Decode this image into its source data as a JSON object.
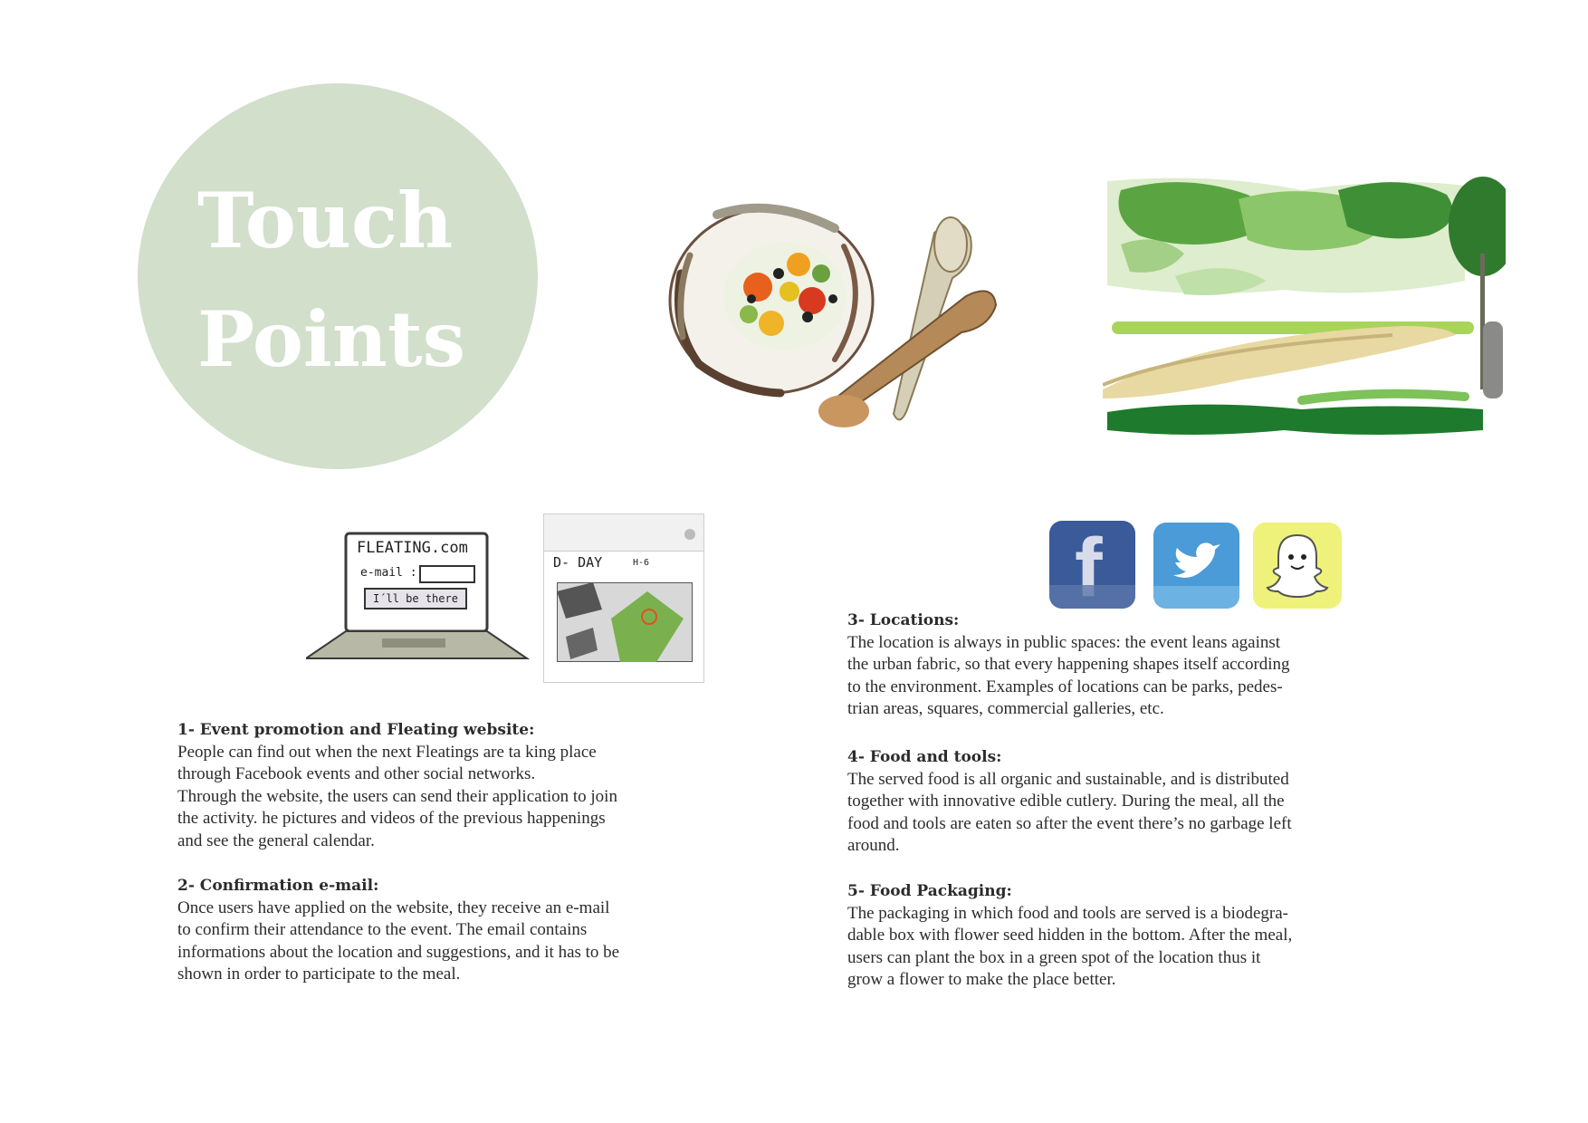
{
  "title": {
    "line1": "Touch",
    "line2": "Points"
  },
  "laptop": {
    "site_name": "FLEATING.com",
    "email_label": "e-mail :",
    "cta": "I´ll be there"
  },
  "email_mock": {
    "heading": "D- DAY",
    "time": "H-6"
  },
  "social": {
    "facebook_letter": "f"
  },
  "colors": {
    "circle": "#d2dfcb",
    "facebook": "#3b5a9a",
    "twitter": "#4a9bd8",
    "snapchat": "#eef27a"
  },
  "sections": [
    {
      "heading": "1- Event promotion and Fleating website:",
      "body": "People can find out when the next Fleatings are ta king place\nthrough Facebook events and other social networks.\nThrough the website, the users can send their application to join\nthe activity. he pictures and videos of the previous happenings\nand see the general calendar."
    },
    {
      "heading": "2- Confirmation e-mail:",
      "body": "Once users have applied on the website, they receive an e-mail\nto confirm their attendance to the event. The email contains\ninformations about the location and suggestions, and it has to be\nshown in order to participate to the meal."
    },
    {
      "heading": "3- Locations:",
      "body": "The location is always in public spaces: the event leans against\nthe urban fabric, so that every happening shapes itself according\nto the environment. Examples of locations can be parks, pedes-\ntrian areas, squares, commercial galleries, etc."
    },
    {
      "heading": "4- Food and tools:",
      "body": "The served food is all organic and sustainable, and is distributed\ntogether with innovative edible cutlery. During the meal, all the\nfood and tools are eaten so after the event there’s no garbage left\naround."
    },
    {
      "heading": "5- Food Packaging:",
      "body": "The packaging in which food and tools are served is a biodegra-\ndable box with flower seed hidden in the bottom. After the meal,\nusers can plant the box in a green spot of the location thus it\ngrow a flower to make the place better."
    }
  ]
}
